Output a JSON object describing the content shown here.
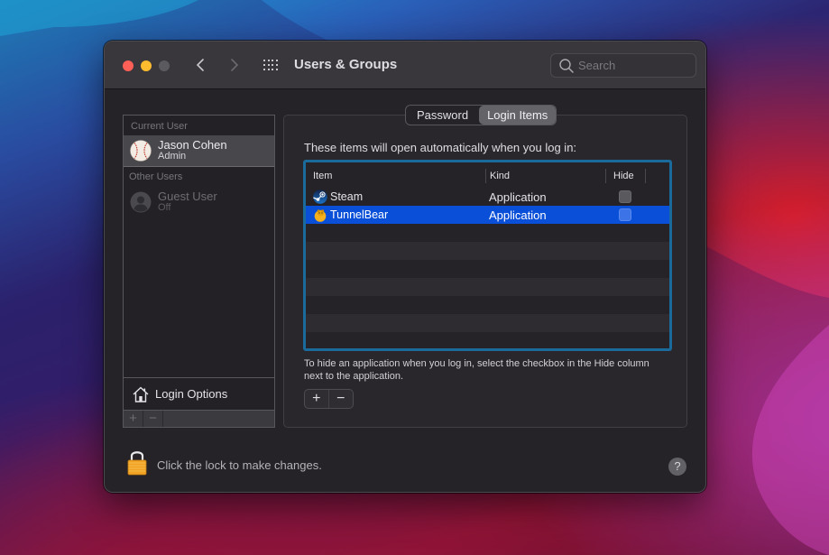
{
  "window": {
    "title": "Users & Groups",
    "traffic_lights": {
      "close": "#fe5f57",
      "minimize": "#febc2e",
      "zoom": "#5b5a5e"
    },
    "nav": {
      "back_icon": "chevron-left-icon",
      "forward_icon": "chevron-right-icon",
      "grid_icon": "show-all-grid-icon"
    },
    "search": {
      "placeholder": "Search",
      "value": ""
    }
  },
  "sidebar": {
    "current_user_header": "Current User",
    "current_user": {
      "name": "Jason Cohen",
      "role": "Admin",
      "avatar": "baseball-avatar",
      "selected": true
    },
    "other_users_header": "Other Users",
    "other_users": [
      {
        "name": "Guest User",
        "status": "Off",
        "avatar": "generic-user-avatar",
        "enabled": false
      }
    ],
    "login_options_label": "Login Options",
    "toolbar": {
      "add": "+",
      "remove": "−"
    }
  },
  "tabs": [
    {
      "label": "Password",
      "active": false
    },
    {
      "label": "Login Items",
      "active": true
    }
  ],
  "login_items": {
    "caption": "These items will open automatically when you log in:",
    "columns": [
      "Item",
      "Kind",
      "Hide"
    ],
    "rows": [
      {
        "name": "Steam",
        "kind": "Application",
        "hide": false,
        "selected": false,
        "icon": "steam-icon"
      },
      {
        "name": "TunnelBear",
        "kind": "Application",
        "hide": false,
        "selected": true,
        "icon": "tunnelbear-icon"
      }
    ],
    "hint": "To hide an application when you log in, select the checkbox in the Hide column next to the application.",
    "add_label": "+",
    "remove_label": "−",
    "accent_color": "#0a4fd8",
    "focus_ring_color": "#1b6a9c"
  },
  "footer": {
    "lock_text": "Click the lock to make changes.",
    "help_label": "?"
  }
}
